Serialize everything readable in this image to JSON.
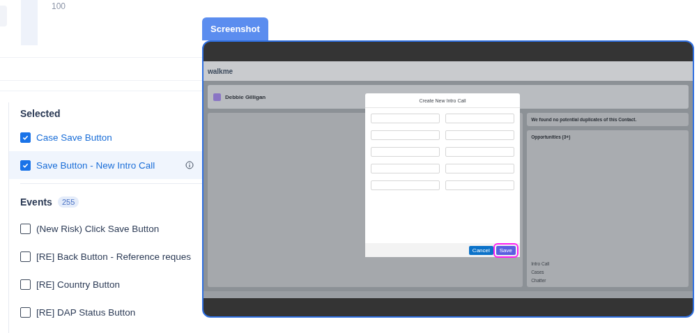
{
  "top": {
    "value": "100"
  },
  "tab": {
    "label": "Screenshot"
  },
  "selected": {
    "title": "Selected",
    "items": [
      {
        "label": "Case Save Button",
        "checked": true,
        "highlighted": false,
        "info": false
      },
      {
        "label": "Save Button - New Intro Call",
        "checked": true,
        "highlighted": true,
        "info": true
      }
    ]
  },
  "events": {
    "title": "Events",
    "count": "255",
    "items": [
      {
        "label": "(New Risk) Click Save Button",
        "checked": false
      },
      {
        "label": "[RE] Back Button - Reference reques",
        "checked": false
      },
      {
        "label": "[RE] Country Button",
        "checked": false
      },
      {
        "label": "[RE] DAP Status Button",
        "checked": false
      }
    ]
  },
  "screenshot": {
    "logo": "walkme",
    "record_name": "Debbie Gilligan",
    "modal_title": "Create New Intro Call",
    "notice": "We found no potential duplicates of this Contact.",
    "card_title": "Opportunities (3+)",
    "sections": [
      "Intro Call",
      "Cases",
      "Chatter"
    ],
    "buttons": [
      {
        "label": "Cancel",
        "kind": "secondary",
        "highlighted": false
      },
      {
        "label": "Save",
        "kind": "primary",
        "highlighted": true
      }
    ]
  }
}
